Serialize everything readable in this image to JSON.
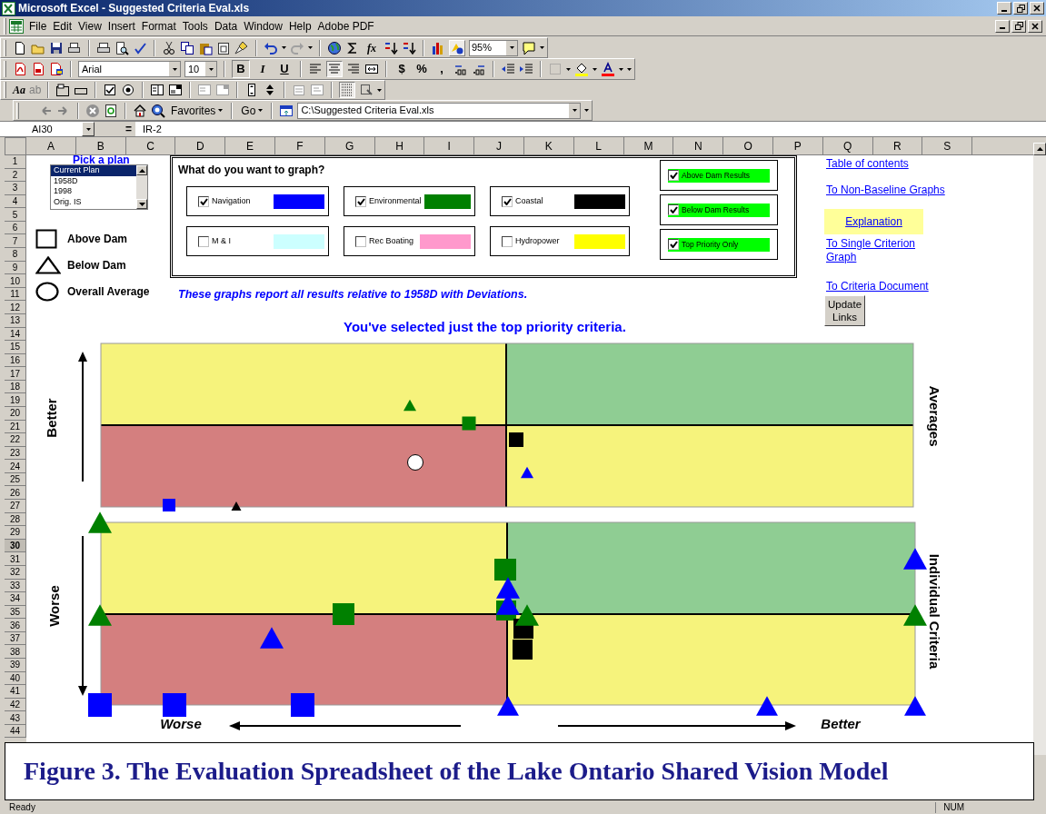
{
  "window": {
    "title": "Microsoft Excel - Suggested Criteria Eval.xls"
  },
  "menu": [
    "File",
    "Edit",
    "View",
    "Insert",
    "Format",
    "Tools",
    "Data",
    "Window",
    "Help",
    "Adobe PDF"
  ],
  "standard_toolbar": {
    "function": "fx",
    "zoom": "95%"
  },
  "formatting_toolbar": {
    "font": "Arial",
    "font_size": "10",
    "styles": [
      "B",
      "I",
      "U"
    ],
    "number_formats": [
      "$",
      "%",
      ","
    ]
  },
  "forms_toolbar": [
    "Aa",
    "ab"
  ],
  "web_toolbar": {
    "favorites": "Favorites",
    "go": "Go",
    "address": "C:\\Suggested Criteria Eval.xls"
  },
  "formula_bar": {
    "name_box": "AI30",
    "equals": "=",
    "formula": "IR-2"
  },
  "columns": [
    "A",
    "B",
    "C",
    "D",
    "E",
    "F",
    "G",
    "H",
    "I",
    "J",
    "K",
    "L",
    "M",
    "N",
    "O",
    "P",
    "Q",
    "R",
    "S"
  ],
  "rows": [
    {
      "label": "1",
      "selected": false
    },
    {
      "label": "2",
      "selected": false
    },
    {
      "label": "3",
      "selected": false
    },
    {
      "label": "4",
      "selected": false
    },
    {
      "label": "5",
      "selected": false
    },
    {
      "label": "6",
      "selected": false
    },
    {
      "label": "7",
      "selected": false
    },
    {
      "label": "8",
      "selected": false
    },
    {
      "label": "9",
      "selected": false
    },
    {
      "label": "10",
      "selected": false
    },
    {
      "label": "11",
      "selected": false
    },
    {
      "label": "12",
      "selected": false
    },
    {
      "label": "13",
      "selected": false
    },
    {
      "label": "14",
      "selected": false
    },
    {
      "label": "15",
      "selected": false
    },
    {
      "label": "16",
      "selected": false
    },
    {
      "label": "17",
      "selected": false
    },
    {
      "label": "18",
      "selected": false
    },
    {
      "label": "19",
      "selected": false
    },
    {
      "label": "20",
      "selected": false
    },
    {
      "label": "21",
      "selected": false
    },
    {
      "label": "22",
      "selected": false
    },
    {
      "label": "23",
      "selected": false
    },
    {
      "label": "24",
      "selected": false
    },
    {
      "label": "25",
      "selected": false
    },
    {
      "label": "26",
      "selected": false
    },
    {
      "label": "27",
      "selected": false
    },
    {
      "label": "28",
      "selected": false
    },
    {
      "label": "29",
      "selected": false
    },
    {
      "label": "30",
      "selected": true
    },
    {
      "label": "31",
      "selected": false
    },
    {
      "label": "32",
      "selected": false
    },
    {
      "label": "33",
      "selected": false
    },
    {
      "label": "34",
      "selected": false
    },
    {
      "label": "35",
      "selected": false
    },
    {
      "label": "36",
      "selected": false
    },
    {
      "label": "37",
      "selected": false
    },
    {
      "label": "38",
      "selected": false
    },
    {
      "label": "39",
      "selected": false
    },
    {
      "label": "40",
      "selected": false
    },
    {
      "label": "41",
      "selected": false
    },
    {
      "label": "42",
      "selected": false
    },
    {
      "label": "43",
      "selected": false
    },
    {
      "label": "44",
      "selected": false
    }
  ],
  "sheet": {
    "plan_picker": {
      "title": "Pick a plan",
      "items": [
        {
          "label": "Current Plan",
          "selected": true
        },
        {
          "label": "1958D",
          "selected": false
        },
        {
          "label": "1998",
          "selected": false
        },
        {
          "label": "Orig. IS",
          "selected": false
        }
      ]
    },
    "legend": [
      {
        "kind": "square",
        "label": "Above Dam"
      },
      {
        "kind": "triangle",
        "label": "Below Dam"
      },
      {
        "kind": "circle",
        "label": "Overall Average"
      }
    ],
    "graph_options": {
      "title": "What do you want to graph?",
      "criteria": [
        {
          "label": "Navigation",
          "checked": true,
          "color": "#0000ff"
        },
        {
          "label": "Environmental",
          "checked": true,
          "color": "#008000"
        },
        {
          "label": "Coastal",
          "checked": true,
          "color": "#000000"
        },
        {
          "label": "M & I",
          "checked": false,
          "color": "#ccffff"
        },
        {
          "label": "Rec Boating",
          "checked": false,
          "color": "#ff99cc"
        },
        {
          "label": "Hydropower",
          "checked": false,
          "color": "#ffff00"
        }
      ],
      "filters": [
        {
          "label": "Above Dam Results",
          "checked": true
        },
        {
          "label": "Below Dam Results",
          "checked": true
        },
        {
          "label": "Top Priority Only",
          "checked": true
        }
      ]
    },
    "note": "These graphs report all results relative to 1958D with Deviations.",
    "links": [
      {
        "label": "Table of contents",
        "highlighted": false
      },
      {
        "label": "To Non-Baseline Graphs",
        "highlighted": false
      },
      {
        "label": "Explanation",
        "highlighted": true
      },
      {
        "label": "To Single Criterion Graph",
        "highlighted": false
      },
      {
        "label": "To Criteria Document",
        "highlighted": false
      }
    ],
    "update_button": "Update Links",
    "heading": "You've selected just the top priority criteria.",
    "graph": {
      "y_better": "Better",
      "y_worse": "Worse",
      "x_worse": "Worse",
      "x_better": "Better",
      "top_panel": "Averages",
      "bottom_panel": "Individual Criteria"
    }
  },
  "caption": "Figure 3. The Evaluation Spreadsheet of the Lake Ontario Shared Vision Model",
  "status_bar": {
    "left": "Ready",
    "right": "NUM"
  }
}
